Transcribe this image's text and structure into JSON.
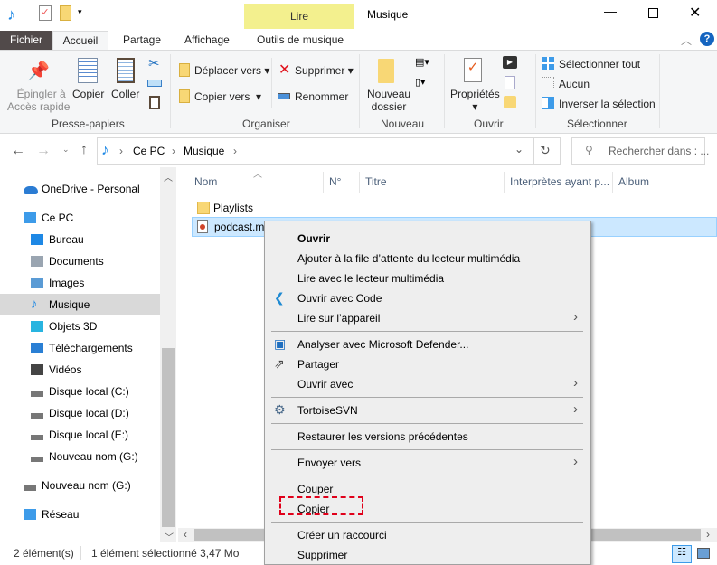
{
  "titlebar": {
    "title": "Musique",
    "context_tab": "Lire",
    "controls": [
      "minimize-icon",
      "maximize-icon",
      "close-icon"
    ]
  },
  "tabs": {
    "fichier": "Fichier",
    "accueil": "Accueil",
    "partage": "Partage",
    "affichage": "Affichage",
    "outils": "Outils de musique"
  },
  "ribbon": {
    "pin1": "Épingler à",
    "pin2": "Accès rapide",
    "copier": "Copier",
    "coller": "Coller",
    "presse": "Presse-papiers",
    "deplacer": "Déplacer vers",
    "copier_vers": "Copier vers",
    "supprimer": "Supprimer",
    "renommer": "Renommer",
    "organiser": "Organiser",
    "nouveau1": "Nouveau",
    "nouveau2": "dossier",
    "nouveau": "Nouveau",
    "proprietes": "Propriétés",
    "ouvrir": "Ouvrir",
    "sel_tout": "Sélectionner tout",
    "aucun": "Aucun",
    "inverser": "Inverser la sélection",
    "selectionner": "Sélectionner"
  },
  "address": {
    "crumbs": [
      "Ce PC",
      "Musique"
    ],
    "search_placeholder": "Rechercher dans : ..."
  },
  "nav": [
    {
      "label": "OneDrive - Personal",
      "indent": 0,
      "icon": "cloud-icon",
      "color": "#2b7cd3"
    },
    {
      "label": "Ce PC",
      "indent": 0,
      "icon": "computer-icon",
      "color": "#3d9be9"
    },
    {
      "label": "Bureau",
      "indent": 1,
      "icon": "desktop-icon",
      "color": "#1e88e5"
    },
    {
      "label": "Documents",
      "indent": 1,
      "icon": "documents-icon",
      "color": "#9aa5b1"
    },
    {
      "label": "Images",
      "indent": 1,
      "icon": "images-icon",
      "color": "#5a9bd5"
    },
    {
      "label": "Musique",
      "indent": 1,
      "icon": "music-icon",
      "color": "#1e88e5",
      "selected": true
    },
    {
      "label": "Objets 3D",
      "indent": 1,
      "icon": "cube-icon",
      "color": "#28b4e0"
    },
    {
      "label": "Téléchargements",
      "indent": 1,
      "icon": "download-icon",
      "color": "#2a7fd4"
    },
    {
      "label": "Vidéos",
      "indent": 1,
      "icon": "video-icon",
      "color": "#444"
    },
    {
      "label": "Disque local (C:)",
      "indent": 1,
      "icon": "drive-icon",
      "color": "#777"
    },
    {
      "label": "Disque local (D:)",
      "indent": 1,
      "icon": "drive-icon",
      "color": "#777"
    },
    {
      "label": "Disque local (E:)",
      "indent": 1,
      "icon": "drive-icon",
      "color": "#777"
    },
    {
      "label": "Nouveau nom (G:)",
      "indent": 1,
      "icon": "drive-icon",
      "color": "#777"
    },
    {
      "label": "Nouveau nom (G:)",
      "indent": 0,
      "icon": "drive-icon",
      "color": "#777"
    },
    {
      "label": "Réseau",
      "indent": 0,
      "icon": "network-icon",
      "color": "#3d9be9"
    }
  ],
  "columns": [
    "Nom",
    "N°",
    "Titre",
    "Interprètes ayant p...",
    "Album"
  ],
  "files": [
    {
      "name": "Playlists",
      "icon": "folder-icon"
    },
    {
      "name": "podcast.m",
      "icon": "media-file-icon",
      "selected": true
    }
  ],
  "context_menu": [
    {
      "label": "Ouvrir",
      "bold": true
    },
    {
      "label": "Ajouter à la file d’attente du lecteur multimédia"
    },
    {
      "label": "Lire avec le lecteur multimédia"
    },
    {
      "label": "Ouvrir avec Code",
      "icon": "vscode-icon"
    },
    {
      "label": "Lire sur l’appareil",
      "submenu": true
    },
    {
      "sep": true
    },
    {
      "label": "Analyser avec Microsoft Defender...",
      "icon": "defender-icon"
    },
    {
      "label": "Partager",
      "icon": "share-icon"
    },
    {
      "label": "Ouvrir avec",
      "submenu": true
    },
    {
      "sep": true
    },
    {
      "label": "TortoiseSVN",
      "icon": "tortoisesvn-icon",
      "submenu": true
    },
    {
      "sep": true
    },
    {
      "label": "Restaurer les versions précédentes"
    },
    {
      "sep": true
    },
    {
      "label": "Envoyer vers",
      "submenu": true
    },
    {
      "sep": true
    },
    {
      "label": "Couper"
    },
    {
      "label": "Copier",
      "highlighted": true
    },
    {
      "sep": true
    },
    {
      "label": "Créer un raccourci"
    },
    {
      "label": "Supprimer"
    }
  ],
  "status": {
    "count": "2 élément(s)",
    "selection": "1 élément sélectionné  3,47 Mo"
  },
  "colors": {
    "selection": "#cce8ff",
    "highlight_box": "#e0001a",
    "context_tab": "#f3f08e"
  }
}
